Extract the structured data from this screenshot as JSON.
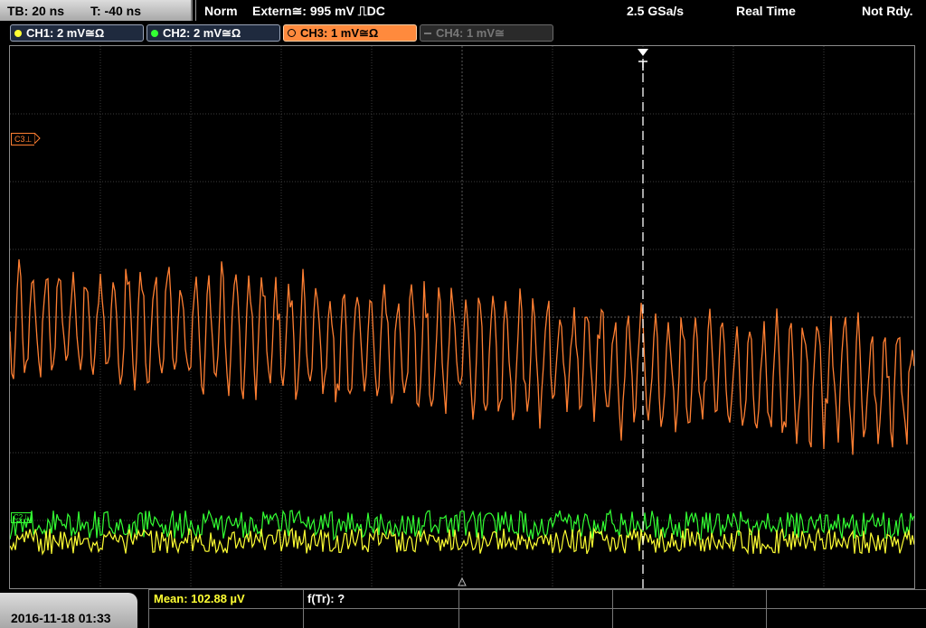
{
  "header": {
    "timebase": "TB: 20 ns",
    "trigger_time": "T: -40 ns",
    "trigger_mode": "Norm",
    "trigger_source": "Extern≅: 995 mV ⎍DC",
    "sample_rate": "2.5 GSa/s",
    "acq_mode": "Real Time",
    "status": "Not Rdy."
  },
  "channels": [
    {
      "label": "CH1: 2 mV≅Ω",
      "color": "#ffff33",
      "active": true
    },
    {
      "label": "CH2: 2 mV≅Ω",
      "color": "#33ff33",
      "active": true
    },
    {
      "label": "CH3: 1 mV≅Ω",
      "color": "#ff7f32",
      "active": true
    },
    {
      "label": "CH4: 1 mV≅",
      "color": "#777777",
      "active": false
    }
  ],
  "markers": {
    "ch3_ref": "C3⊥",
    "ch_ref_low": "C2⊥"
  },
  "footer": {
    "datetime": "2016-11-18 01:33",
    "mean": "Mean: 102.88 µV",
    "freq": "f(Tr): ?"
  },
  "colors": {
    "ch1": "#ffff33",
    "ch2": "#33ff33",
    "ch3": "#ff7f32",
    "grid": "#505050",
    "mean_text": "#ffff33"
  },
  "icons": {
    "trigger_marker": "trigger-arrow-icon",
    "ref_marker": "ground-ref-icon"
  }
}
